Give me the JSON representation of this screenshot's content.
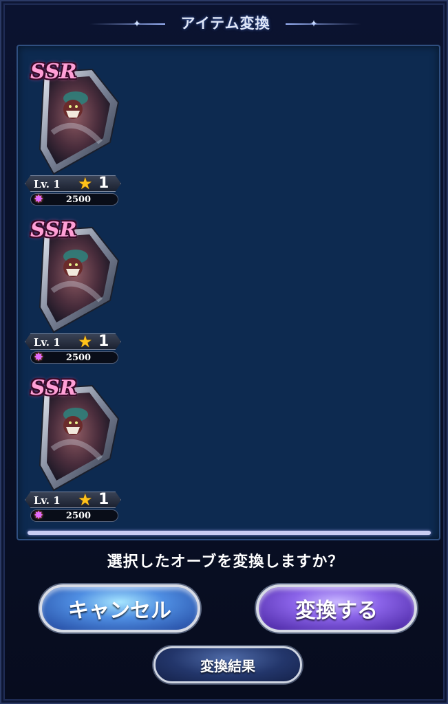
{
  "header": {
    "title": "アイテム変換"
  },
  "orbs": [
    {
      "rarity": "SSR",
      "level_label": "Lv. 1",
      "stars": "1",
      "points": "2500"
    },
    {
      "rarity": "SSR",
      "level_label": "Lv. 1",
      "stars": "1",
      "points": "2500"
    },
    {
      "rarity": "SSR",
      "level_label": "Lv. 1",
      "stars": "1",
      "points": "2500"
    }
  ],
  "prompt": {
    "question": "選択したオーブを変換しますか？"
  },
  "buttons": {
    "cancel_label": "キャンセル",
    "convert_label": "変換する",
    "result_label": "変換結果"
  },
  "colors": {
    "panel_bg": "#0d2a50",
    "rarity_pink": "#ff9fd6",
    "cancel_blue": "#4f8ee2",
    "convert_purple": "#8a63e8",
    "star_gold": "#ffc21a"
  },
  "icons": {
    "star": "star-icon",
    "crystal": "crystal-icon",
    "orb": "shield-orb-icon"
  }
}
